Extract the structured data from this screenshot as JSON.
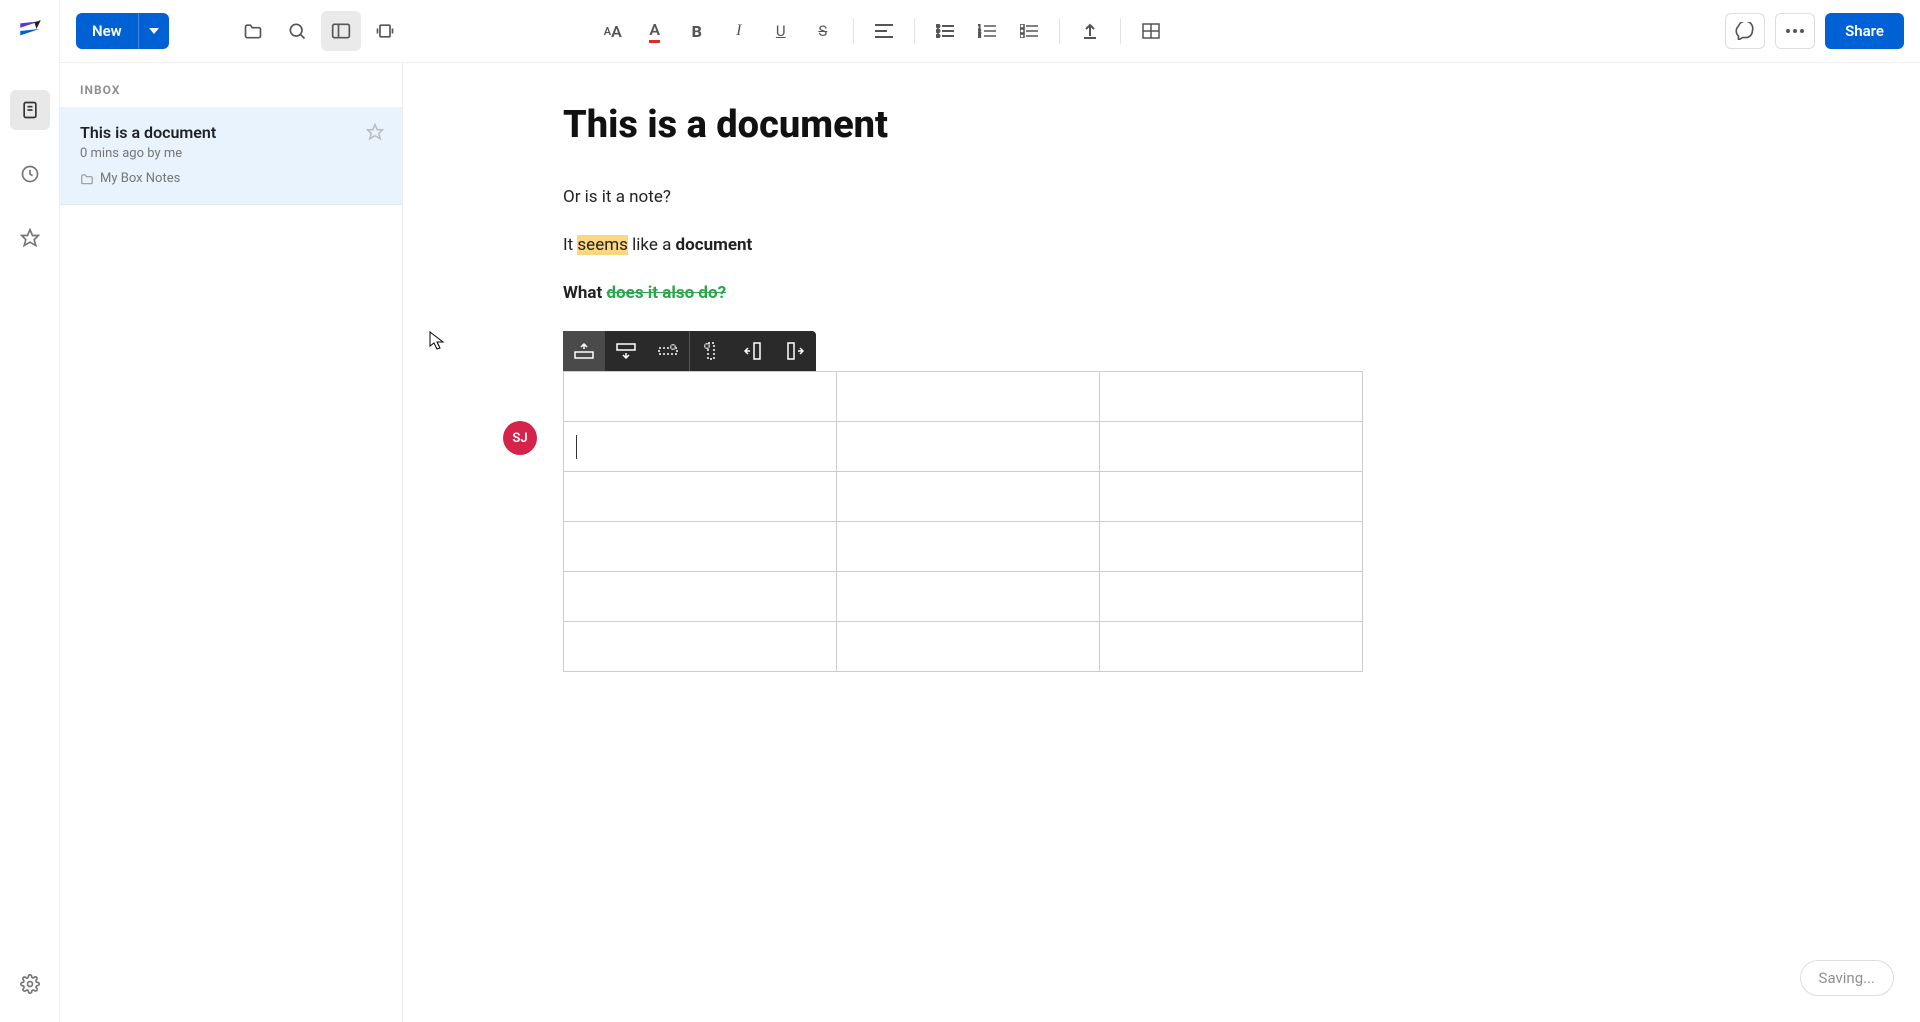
{
  "rail": {
    "items": [
      "documents",
      "recent",
      "starred",
      "settings"
    ]
  },
  "toolbar": {
    "new_label": "New",
    "share_label": "Share"
  },
  "sidebar": {
    "header": "INBOX",
    "notes": [
      {
        "title": "This is a document",
        "meta": "0 mins ago by me",
        "folder": "My Box Notes"
      }
    ]
  },
  "document": {
    "title": "This is a document",
    "para1": "Or is it a note?",
    "para2_pre": "It ",
    "para2_hl": "seems",
    "para2_mid": " like a ",
    "para2_bold": "document",
    "para3_pre": "What ",
    "para3_green": "does it also do?",
    "table": {
      "rows": 6,
      "cols": 3
    }
  },
  "avatar": {
    "initials": "SJ"
  },
  "status": {
    "saving": "Saving..."
  }
}
